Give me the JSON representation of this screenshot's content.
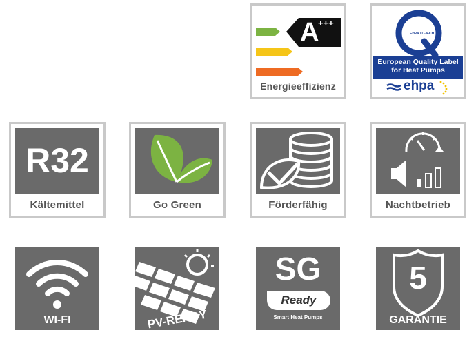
{
  "energy": {
    "grade_letter": "A",
    "grade_plus": "+++",
    "label": "Energieeffizienz",
    "colors": [
      "#7cb342",
      "#f5c518",
      "#ee6b23"
    ]
  },
  "ehpa": {
    "letter": "Q",
    "small_text": "EHPA / D-A-CH",
    "banner_line1": "European Quality Label",
    "banner_line2": "for Heat Pumps",
    "brand": "ehpa",
    "brand_color": "#1b3f94"
  },
  "row2": [
    {
      "panel_text": "R32",
      "label": "Kältemittel"
    },
    {
      "label": "Go Green"
    },
    {
      "label": "Förderfähig"
    },
    {
      "label": "Nachtbetrieb"
    }
  ],
  "row3": [
    {
      "label": "WI-FI"
    },
    {
      "label": "PV-READY"
    },
    {
      "big": "SG",
      "pill": "Ready",
      "sub": "Smart Heat Pumps"
    },
    {
      "number": "5",
      "label": "GARANTIE"
    }
  ]
}
